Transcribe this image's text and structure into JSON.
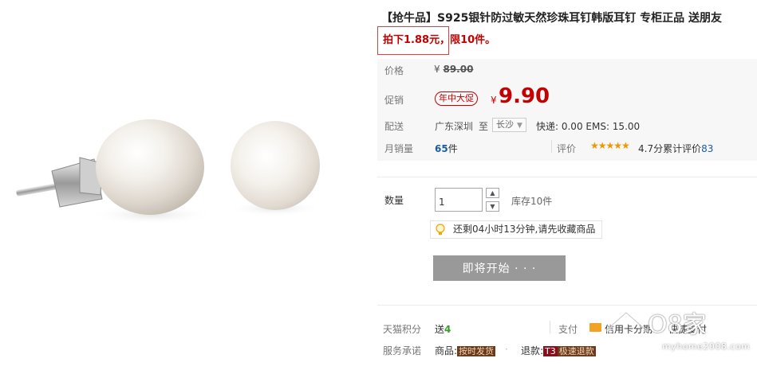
{
  "product": {
    "title": "【抢牛品】S925银针防过敏天然珍珠耳钉韩版耳钉 专柜正品 送朋友",
    "promo_prefix": "拍下1.88元，",
    "promo_suffix": "限10件。"
  },
  "price": {
    "label": "价格",
    "currency": "¥",
    "original": "89.00"
  },
  "promotion": {
    "label": "促销",
    "badge": "年中大促",
    "currency": "¥",
    "price": "9.90"
  },
  "shipping": {
    "label": "配送",
    "from": "广东深圳",
    "to_word": "至",
    "to_city": "长沙",
    "fees": "快递: 0.00 EMS: 15.00"
  },
  "sales": {
    "label": "月销量",
    "count": "65",
    "unit": "件"
  },
  "rating": {
    "label": "评价",
    "stars": "★★★★★",
    "score": "4.7分",
    "count_label": "累计评价",
    "count": "83"
  },
  "quantity": {
    "label": "数量",
    "value": "1",
    "stock": "库存10件",
    "up_glyph": "▲",
    "down_glyph": "▼"
  },
  "reminder": {
    "text": "还剩04小时13分钟,请先收藏商品"
  },
  "actions": {
    "start_label": "即将开始 · · ·"
  },
  "points": {
    "label": "天猫积分",
    "prefix": "送",
    "value": "4"
  },
  "payment": {
    "label": "支付",
    "card": "信用卡分期",
    "express": "快捷支付"
  },
  "promise": {
    "label": "服务承诺",
    "goods_prefix": "商品:",
    "goods_tag": "按时发货",
    "separator": "·",
    "return_prefix": "退款:",
    "return_tag1": "T3",
    "return_tag2": "极速退款"
  },
  "watermark": {
    "line1": "O8家",
    "line2": "myhome2008.com"
  },
  "colors": {
    "accent_red": "#c40000",
    "link_blue": "#1b5c9e",
    "star_orange": "#f19800",
    "button_gray": "#999999"
  }
}
